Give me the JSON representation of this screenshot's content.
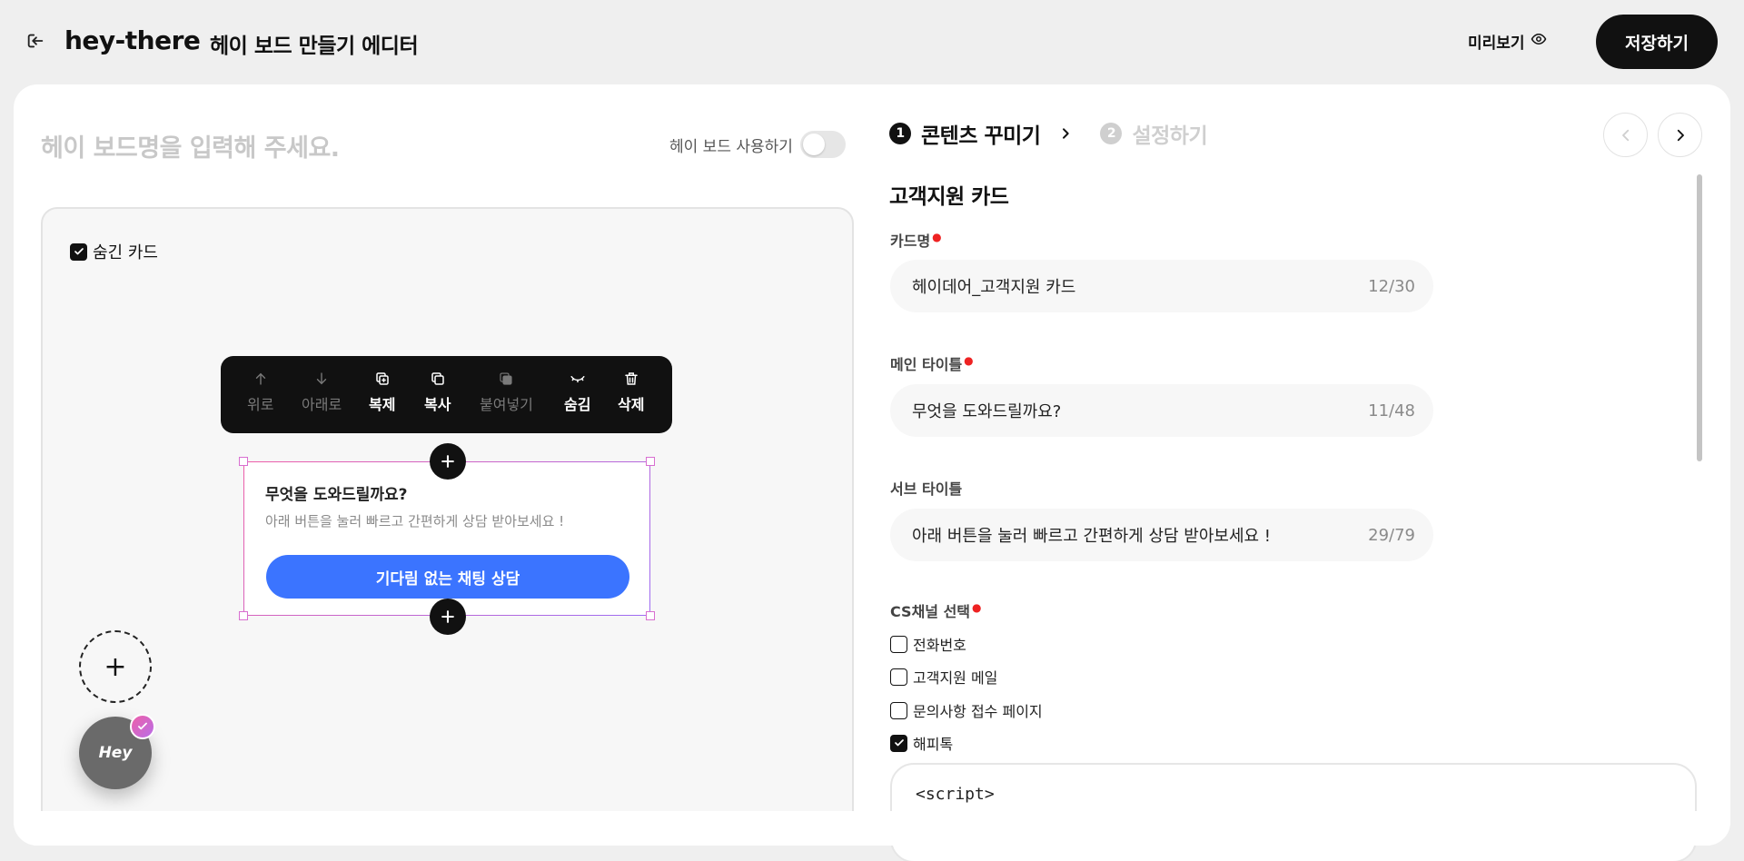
{
  "header": {
    "brand": "hey-there",
    "title": "헤이 보드 만들기 에디터",
    "preview_label": "미리보기",
    "save_label": "저장하기"
  },
  "editor": {
    "board_name_placeholder": "헤이 보드명을 입력해 주세요.",
    "use_board_label": "헤이 보드 사용하기",
    "use_board_on": false,
    "hidden_card_label": "숨긴 카드",
    "hidden_card_checked": true
  },
  "toolbar": {
    "items": [
      {
        "label": "위로",
        "icon": "arrow-up-icon",
        "enabled": false
      },
      {
        "label": "아래로",
        "icon": "arrow-down-icon",
        "enabled": false
      },
      {
        "label": "복제",
        "icon": "duplicate-icon",
        "enabled": true
      },
      {
        "label": "복사",
        "icon": "copy-icon",
        "enabled": true
      },
      {
        "label": "붙여넣기",
        "icon": "paste-icon",
        "enabled": false
      },
      {
        "label": "숨김",
        "icon": "eye-closed-icon",
        "enabled": true
      },
      {
        "label": "삭제",
        "icon": "trash-icon",
        "enabled": true
      }
    ]
  },
  "card": {
    "title": "무엇을 도와드릴까요?",
    "subtitle": "아래 버튼을 눌러 빠르고 간편하게 상담 받아보세요 !",
    "button": "기다림 없는 채팅 상담"
  },
  "widget": {
    "add_symbol": "+",
    "bubble_label": "Hey"
  },
  "steps": {
    "step1_num": "1",
    "step1": "콘텐츠 꾸미기",
    "step2_num": "2",
    "step2": "설정하기"
  },
  "form": {
    "section_title": "고객지원 카드",
    "card_name": {
      "label": "카드명",
      "value": "헤이데어_고객지원 카드",
      "count": "12/30"
    },
    "main_title": {
      "label": "메인 타이틀",
      "value": "무엇을 도와드릴까요?",
      "count": "11/48"
    },
    "sub_title": {
      "label": "서브 타이틀",
      "value": "아래 버튼을 눌러 빠르고 간편하게 상담 받아보세요 !",
      "count": "29/79"
    },
    "cs_channel": {
      "label": "CS채널 선택",
      "options": [
        {
          "label": "전화번호",
          "checked": false
        },
        {
          "label": "고객지원 메일",
          "checked": false
        },
        {
          "label": "문의사항 접수 페이지",
          "checked": false
        },
        {
          "label": "해피톡",
          "checked": true
        }
      ]
    },
    "script_text": "<script>"
  }
}
